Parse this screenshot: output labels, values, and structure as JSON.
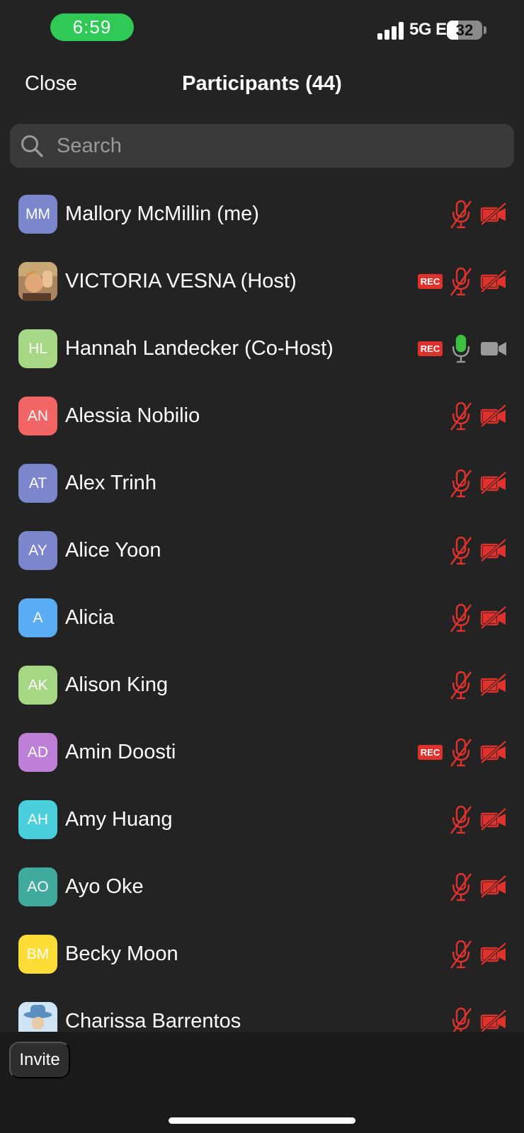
{
  "status_bar": {
    "time": "6:59",
    "network": "5G E",
    "battery": "32",
    "signal_bars": 4
  },
  "header": {
    "close_label": "Close",
    "title": "Participants (44)"
  },
  "search": {
    "placeholder": "Search",
    "icon": "search-icon"
  },
  "participants": [
    {
      "initials": "MM",
      "name": "Mallory McMillin (me)",
      "avatar_color": "#7b86cc",
      "rec": false,
      "mic": "muted",
      "camera": "off"
    },
    {
      "initials": "",
      "name": "VICTORIA VESNA (Host)",
      "avatar_color": "#8a6a4a",
      "photo": true,
      "rec": true,
      "mic": "muted",
      "camera": "off"
    },
    {
      "initials": "HL",
      "name": "Hannah Landecker (Co-Host)",
      "avatar_color": "#a6d784",
      "rec": true,
      "mic": "active",
      "camera": "on"
    },
    {
      "initials": "AN",
      "name": "Alessia Nobilio",
      "avatar_color": "#f26565",
      "rec": false,
      "mic": "muted",
      "camera": "off"
    },
    {
      "initials": "AT",
      "name": "Alex Trinh",
      "avatar_color": "#7b86cc",
      "rec": false,
      "mic": "muted",
      "camera": "off"
    },
    {
      "initials": "AY",
      "name": "Alice Yoon",
      "avatar_color": "#7b86cc",
      "rec": false,
      "mic": "muted",
      "camera": "off"
    },
    {
      "initials": "A",
      "name": "Alicia",
      "avatar_color": "#5aacf3",
      "rec": false,
      "mic": "muted",
      "camera": "off"
    },
    {
      "initials": "AK",
      "name": "Alison King",
      "avatar_color": "#a6d784",
      "rec": false,
      "mic": "muted",
      "camera": "off"
    },
    {
      "initials": "AD",
      "name": "Amin Doosti",
      "avatar_color": "#bd80d6",
      "rec": true,
      "mic": "muted",
      "camera": "off"
    },
    {
      "initials": "AH",
      "name": "Amy Huang",
      "avatar_color": "#49d0dc",
      "rec": false,
      "mic": "muted",
      "camera": "off"
    },
    {
      "initials": "AO",
      "name": "Ayo Oke",
      "avatar_color": "#41aa9f",
      "rec": false,
      "mic": "muted",
      "camera": "off"
    },
    {
      "initials": "BM",
      "name": "Becky Moon",
      "avatar_color": "#fddd35",
      "rec": false,
      "mic": "muted",
      "camera": "off"
    },
    {
      "initials": "",
      "name": "Charissa Barrentos",
      "avatar_color": "#cfe4f4",
      "photo": true,
      "rec": false,
      "mic": "muted",
      "camera": "off"
    }
  ],
  "labels": {
    "rec": "REC"
  },
  "colors": {
    "muted": "#e0322c",
    "active_mic": "#3fbf3f",
    "camera_on": "#9a9a9a",
    "background": "#232323"
  },
  "footer": {
    "invite_label": "Invite"
  }
}
